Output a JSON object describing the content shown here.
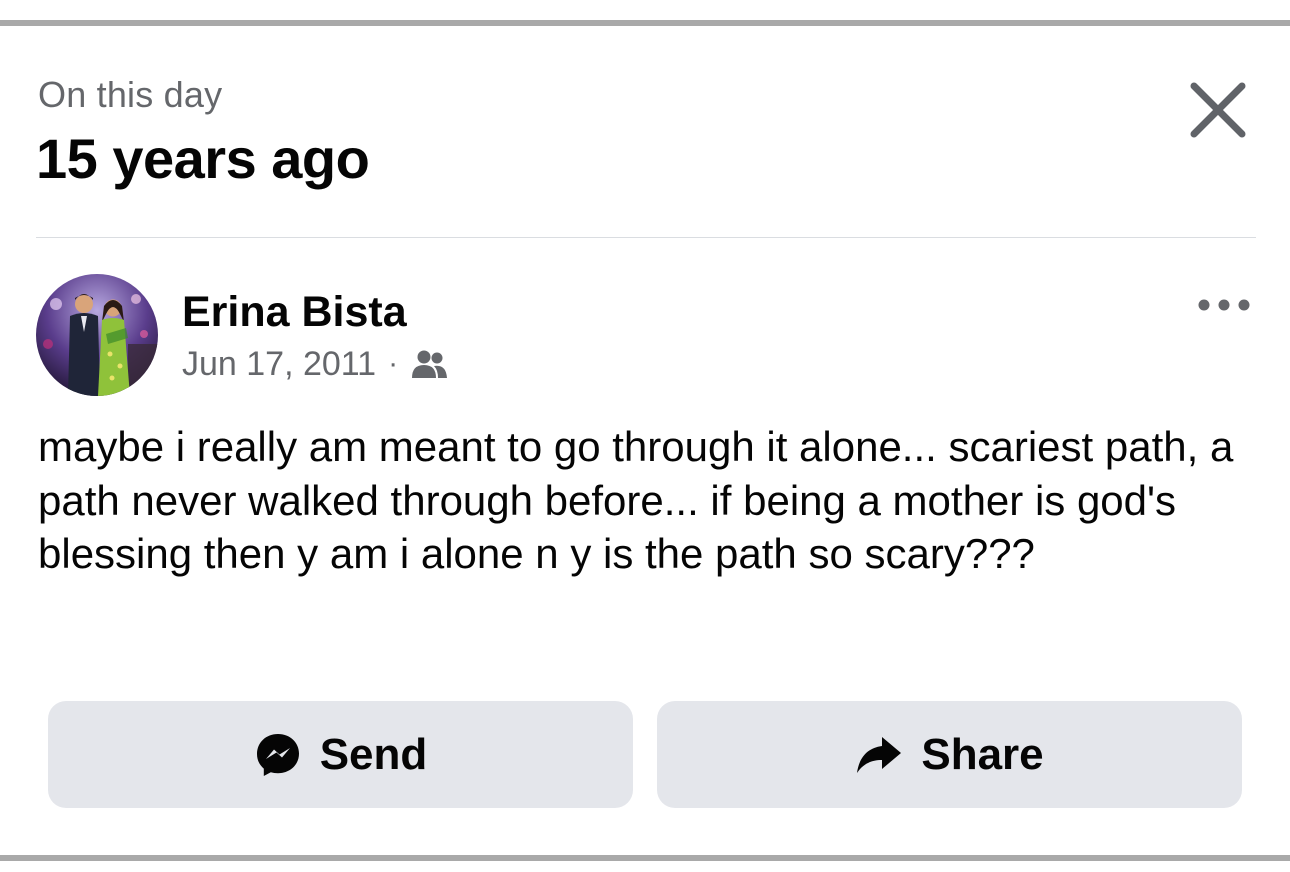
{
  "memory_header": {
    "kicker": "On this day",
    "headline": "15 years ago",
    "close_icon": "close-icon"
  },
  "post": {
    "author": "Erina Bista",
    "date": "Jun 17, 2011",
    "separator": "·",
    "audience_icon": "friends-icon",
    "more_icon": "more-dots-icon",
    "text": "maybe i really am meant to go through it alone... scariest path, a path never walked through before... if being a mother is god's blessing then y am i alone n y is the path so scary???"
  },
  "actions": {
    "send_label": "Send",
    "send_icon": "messenger-icon",
    "share_label": "Share",
    "share_icon": "share-arrow-icon"
  },
  "colors": {
    "secondary_text": "#65676b",
    "primary_text": "#050505",
    "button_bg": "#e4e6eb",
    "divider": "#dadde1"
  }
}
